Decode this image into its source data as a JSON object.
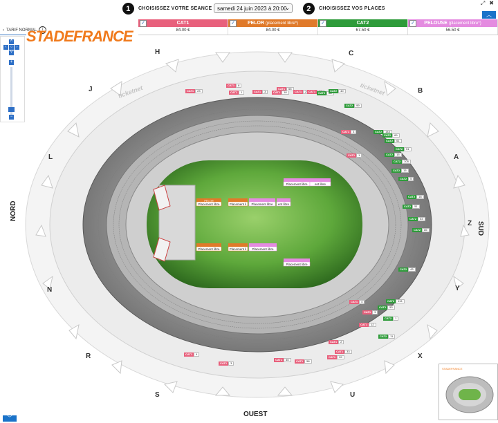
{
  "header": {
    "step1_num": "1",
    "step1_label": "CHOISISSEZ VOTRE SEANCE",
    "session_value": "samedi 24 juin 2023 à 20:00",
    "step2_num": "2",
    "step2_label": "CHOISISSEZ VOS PLACES"
  },
  "categories": [
    {
      "name": "CAT1",
      "sub": "",
      "price": "84.00 €",
      "color": "#e8607c"
    },
    {
      "name": "PELOR",
      "sub": "(placement libre*)",
      "price": "84.00 €",
      "color": "#e07a2a"
    },
    {
      "name": "CAT2",
      "sub": "",
      "price": "67.50 €",
      "color": "#2e9b3a"
    },
    {
      "name": "PELOUSE",
      "sub": "(placement libre*)",
      "price": "56.50 €",
      "color": "#e48be0"
    }
  ],
  "tarif": {
    "label": "TARIF NORMAL",
    "info_icon": "i"
  },
  "logo_text": "STADEFRANCE",
  "watermark": "ticketnet",
  "directions": {
    "north": "NORD",
    "south": "SUD",
    "west": "OUEST"
  },
  "gates": [
    "H",
    "C",
    "J",
    "B",
    "L",
    "A",
    "Z",
    "N",
    "Y",
    "R",
    "X",
    "S",
    "U"
  ],
  "icons": {
    "external": "external-link-icon",
    "close": "close-icon",
    "up": "chevron-up-icon",
    "down": "chevron-down-icon"
  },
  "field_labels": {
    "pelor_top": "PELOR",
    "pelor_sub": "Placement libre",
    "pelouse_top": "PELOUSE",
    "pelouse_sub": "Placement libre"
  },
  "seat_tags": [
    {
      "cat": "CAT1",
      "n": "23"
    },
    {
      "cat": "CAT1",
      "n": "8"
    },
    {
      "cat": "CAT1",
      "n": "1"
    },
    {
      "cat": "CAT1",
      "n": "3"
    },
    {
      "cat": "CAT1",
      "n": "65"
    },
    {
      "cat": "CAT1",
      "n": "18"
    },
    {
      "cat": "CAT1",
      "n": "29"
    },
    {
      "cat": "CAT1",
      "n": "73"
    },
    {
      "cat": "CAT2",
      "n": "88"
    },
    {
      "cat": "CAT2",
      "n": "40"
    },
    {
      "cat": "CAT2",
      "n": "99"
    },
    {
      "cat": "CAT2",
      "n": "144"
    },
    {
      "cat": "CAT2",
      "n": "69"
    },
    {
      "cat": "CAT2",
      "n": "61"
    },
    {
      "cat": "CAT2",
      "n": "51"
    },
    {
      "cat": "CAT2",
      "n": "15"
    },
    {
      "cat": "CAT2",
      "n": "105"
    },
    {
      "cat": "CAT2",
      "n": "15"
    },
    {
      "cat": "CAT2",
      "n": "5"
    },
    {
      "cat": "CAT2",
      "n": "18"
    },
    {
      "cat": "CAT2",
      "n": "51"
    },
    {
      "cat": "CAT2",
      "n": "53"
    },
    {
      "cat": "CAT2",
      "n": "85"
    },
    {
      "cat": "CAT2",
      "n": "43"
    },
    {
      "cat": "CAT2",
      "n": "113"
    },
    {
      "cat": "CAT2",
      "n": "53"
    },
    {
      "cat": "CAT2",
      "n": "1"
    },
    {
      "cat": "CAT2",
      "n": "11"
    },
    {
      "cat": "CAT1",
      "n": "1"
    },
    {
      "cat": "CAT1",
      "n": "3"
    },
    {
      "cat": "CAT1",
      "n": "4"
    },
    {
      "cat": "CAT1",
      "n": "3"
    },
    {
      "cat": "CAT1",
      "n": "12"
    },
    {
      "cat": "CAT1",
      "n": "2"
    },
    {
      "cat": "CAT1",
      "n": "33"
    },
    {
      "cat": "CAT1",
      "n": "39"
    },
    {
      "cat": "CAT1",
      "n": "58"
    },
    {
      "cat": "CAT1",
      "n": "40"
    },
    {
      "cat": "CAT1",
      "n": "4"
    },
    {
      "cat": "CAT1",
      "n": "3"
    }
  ]
}
